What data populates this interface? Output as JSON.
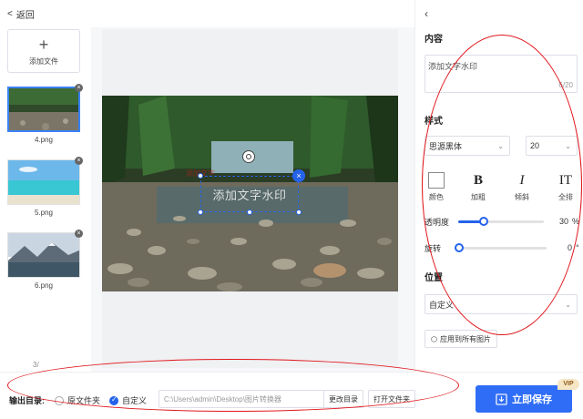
{
  "topbar": {
    "back_label": "返回"
  },
  "left": {
    "add_file_label": "添加文件",
    "thumbnails": [
      {
        "name": "4.png",
        "selected": true
      },
      {
        "name": "5.png",
        "selected": false
      },
      {
        "name": "6.png",
        "selected": false
      }
    ],
    "page_indicator": "3/"
  },
  "canvas": {
    "watermark_text": "添加文字水印",
    "ghost_text": "添加文字"
  },
  "settings": {
    "content_title": "内容",
    "content_value": "添加文字水印",
    "char_count": "6/20",
    "style_title": "样式",
    "font_family": "思源黑体",
    "font_size": "20",
    "style_buttons": [
      {
        "glyph": "",
        "label": "颜色",
        "icon": "color-swatch-icon"
      },
      {
        "glyph": "B",
        "label": "加粗",
        "icon": "bold-icon"
      },
      {
        "glyph": "I",
        "label": "倾斜",
        "icon": "italic-icon"
      },
      {
        "glyph": "IT",
        "label": "全排",
        "icon": "text-layout-icon"
      }
    ],
    "opacity": {
      "label": "透明度",
      "value": 30,
      "display": "30",
      "unit": "%"
    },
    "rotation": {
      "label": "旋转",
      "value": 0,
      "display": "0",
      "unit": "°"
    },
    "position_title": "位置",
    "position_value": "自定义",
    "apply_all_label": "应用到所有图片"
  },
  "bottom": {
    "output_label": "输出目录:",
    "radio_original": "原文件夹",
    "radio_custom": "自定义",
    "path_value": "C:\\Users\\admin\\Desktop\\图片转换器",
    "change_dir_label": "更改目录",
    "open_folder_label": "打开文件夹",
    "save_label": "立即保存",
    "vip_badge": "VIP"
  },
  "colors": {
    "accent": "#2f6df6",
    "annotation": "#e0161b"
  }
}
